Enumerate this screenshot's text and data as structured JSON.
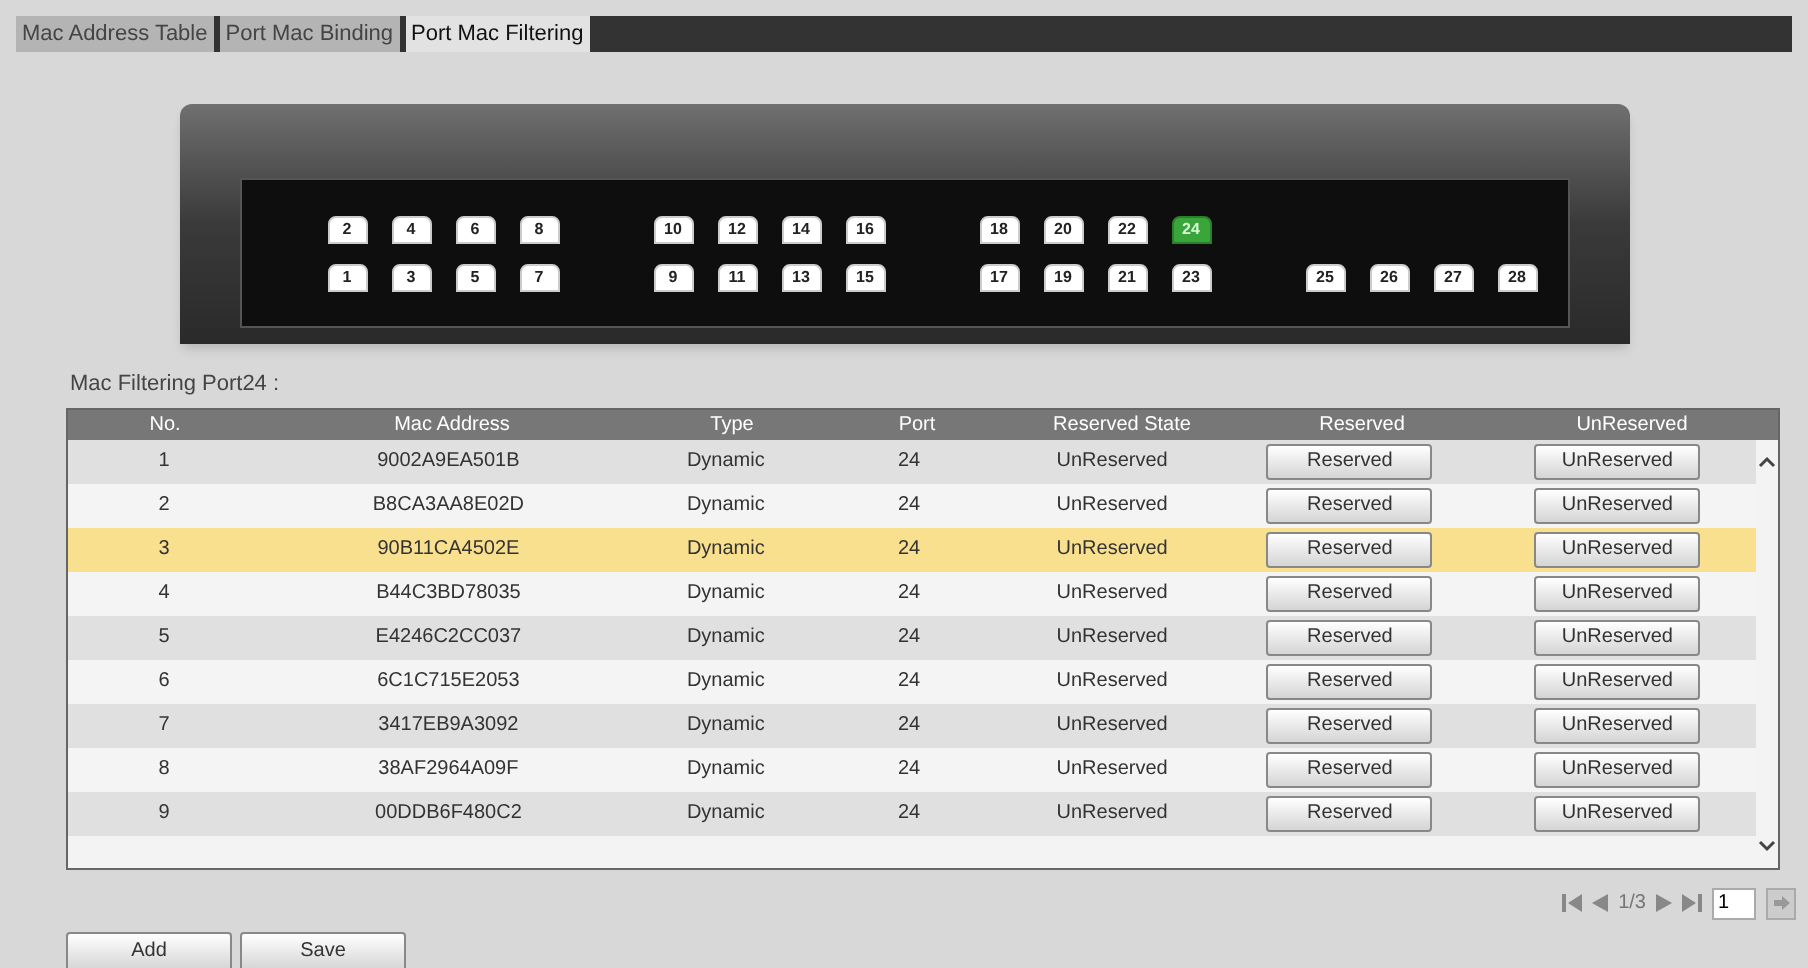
{
  "tabs": [
    {
      "label": "Mac Address Table",
      "selected": false
    },
    {
      "label": "Port Mac Binding",
      "selected": false
    },
    {
      "label": "Port Mac Filtering",
      "selected": true
    }
  ],
  "switch": {
    "top_groups": [
      [
        {
          "label": "2",
          "selected": false
        },
        {
          "label": "4",
          "selected": false
        },
        {
          "label": "6",
          "selected": false
        },
        {
          "label": "8",
          "selected": false
        }
      ],
      [
        {
          "label": "10",
          "selected": false
        },
        {
          "label": "12",
          "selected": false
        },
        {
          "label": "14",
          "selected": false
        },
        {
          "label": "16",
          "selected": false
        }
      ],
      [
        {
          "label": "18",
          "selected": false
        },
        {
          "label": "20",
          "selected": false
        },
        {
          "label": "22",
          "selected": false
        },
        {
          "label": "24",
          "selected": true
        }
      ]
    ],
    "bottom_groups": [
      [
        {
          "label": "1",
          "selected": false
        },
        {
          "label": "3",
          "selected": false
        },
        {
          "label": "5",
          "selected": false
        },
        {
          "label": "7",
          "selected": false
        }
      ],
      [
        {
          "label": "9",
          "selected": false
        },
        {
          "label": "11",
          "selected": false
        },
        {
          "label": "13",
          "selected": false
        },
        {
          "label": "15",
          "selected": false
        }
      ],
      [
        {
          "label": "17",
          "selected": false
        },
        {
          "label": "19",
          "selected": false
        },
        {
          "label": "21",
          "selected": false
        },
        {
          "label": "23",
          "selected": false
        }
      ],
      [
        {
          "label": "25",
          "selected": false
        },
        {
          "label": "26",
          "selected": false
        },
        {
          "label": "27",
          "selected": false
        },
        {
          "label": "28",
          "selected": false
        }
      ]
    ]
  },
  "section_title": "Mac Filtering Port24 :",
  "table": {
    "columns": [
      "No.",
      "Mac Address",
      "Type",
      "Port",
      "Reserved State",
      "Reserved",
      "UnReserved"
    ],
    "rows": [
      {
        "no": "1",
        "mac": "9002A9EA501B",
        "type": "Dynamic",
        "port": "24",
        "state": "UnReserved",
        "reserve": "Reserved",
        "unreserve": "UnReserved",
        "selected": false
      },
      {
        "no": "2",
        "mac": "B8CA3AA8E02D",
        "type": "Dynamic",
        "port": "24",
        "state": "UnReserved",
        "reserve": "Reserved",
        "unreserve": "UnReserved",
        "selected": false
      },
      {
        "no": "3",
        "mac": "90B11CA4502E",
        "type": "Dynamic",
        "port": "24",
        "state": "UnReserved",
        "reserve": "Reserved",
        "unreserve": "UnReserved",
        "selected": true
      },
      {
        "no": "4",
        "mac": "B44C3BD78035",
        "type": "Dynamic",
        "port": "24",
        "state": "UnReserved",
        "reserve": "Reserved",
        "unreserve": "UnReserved",
        "selected": false
      },
      {
        "no": "5",
        "mac": "E4246C2CC037",
        "type": "Dynamic",
        "port": "24",
        "state": "UnReserved",
        "reserve": "Reserved",
        "unreserve": "UnReserved",
        "selected": false
      },
      {
        "no": "6",
        "mac": "6C1C715E2053",
        "type": "Dynamic",
        "port": "24",
        "state": "UnReserved",
        "reserve": "Reserved",
        "unreserve": "UnReserved",
        "selected": false
      },
      {
        "no": "7",
        "mac": "3417EB9A3092",
        "type": "Dynamic",
        "port": "24",
        "state": "UnReserved",
        "reserve": "Reserved",
        "unreserve": "UnReserved",
        "selected": false
      },
      {
        "no": "8",
        "mac": "38AF2964A09F",
        "type": "Dynamic",
        "port": "24",
        "state": "UnReserved",
        "reserve": "Reserved",
        "unreserve": "UnReserved",
        "selected": false
      },
      {
        "no": "9",
        "mac": "00DDB6F480C2",
        "type": "Dynamic",
        "port": "24",
        "state": "UnReserved",
        "reserve": "Reserved",
        "unreserve": "UnReserved",
        "selected": false
      }
    ]
  },
  "pagination": {
    "page": "1/3",
    "page_input": "1"
  },
  "buttons": [
    "Add",
    "Save"
  ]
}
